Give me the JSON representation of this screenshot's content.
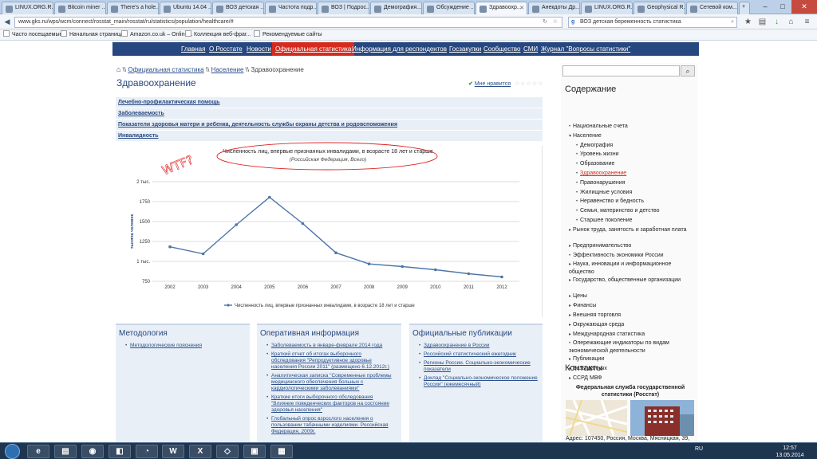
{
  "browser": {
    "tabs": [
      {
        "label": "LINUX.ORG.R...",
        "icon": "globe-icon"
      },
      {
        "label": "Bitcoin miner ...",
        "icon": "bitcoin-icon"
      },
      {
        "label": "There's a hole...",
        "icon": "hole-icon"
      },
      {
        "label": "Ubuntu 14.04 ...",
        "icon": "ubuntu-icon"
      },
      {
        "label": "ВОЗ детская ...",
        "icon": "google-icon"
      },
      {
        "label": "Частота подр...",
        "icon": "wikipedia-icon"
      },
      {
        "label": "ВОЗ | Подрос...",
        "icon": "who-icon"
      },
      {
        "label": "Демография...",
        "icon": "wikipedia-icon"
      },
      {
        "label": "Обсуждение ...",
        "icon": "c-icon"
      },
      {
        "label": "Здравоохр...",
        "icon": "rosstat-icon",
        "active": true
      },
      {
        "label": "Анекдоты Др...",
        "icon": "smile-icon"
      },
      {
        "label": "LINUX.ORG.R...",
        "icon": "globe-icon"
      },
      {
        "label": "Geophysical R...",
        "icon": "wikipedia-icon"
      },
      {
        "label": "Сетевой ком...",
        "icon": "wikipedia-icon"
      }
    ],
    "url": "www.gks.ru/wps/wcm/connect/rosstat_main/rosstat/ru/statistics/population/healthcare/#",
    "search_value": "ВОЗ детская беременность статистика",
    "bookmarks": [
      {
        "label": "Часто посещаемые"
      },
      {
        "label": "Начальная страница"
      },
      {
        "label": "Amazon.co.uk – Online..."
      },
      {
        "label": "Коллекция веб-фраг..."
      },
      {
        "label": "Рекомендуемые сайты"
      }
    ]
  },
  "site": {
    "nav": [
      {
        "label": "Главная"
      },
      {
        "label": "О Росстате"
      },
      {
        "label": "Новости"
      },
      {
        "label": "Официальная статистика",
        "active": true
      },
      {
        "label": "Информация для респондентов"
      },
      {
        "label": "Госзакупки"
      },
      {
        "label": "Сообщество"
      },
      {
        "label": "СМИ"
      },
      {
        "label": "Журнал \"Вопросы статистики\""
      }
    ],
    "breadcrumb": {
      "sep": "\\\\",
      "items": [
        "Официальная статистика",
        "Население",
        "Здравоохранение"
      ]
    },
    "page_title": "Здравоохранение",
    "like_label": "Мне нравится",
    "rating_stars": "☆☆☆☆☆",
    "sublinks": [
      "Лечебно-профилактическая помощь",
      "Заболеваемость",
      "Показатели здоровья матери и ребенка, деятельность службы охраны детства и родовспоможения",
      "Инвалидность"
    ],
    "annotation_text": "WTF?",
    "boxes": [
      {
        "title": "Методология",
        "items": [
          "Методологические пояснения"
        ]
      },
      {
        "title": "Оперативная информация",
        "items": [
          "Заболеваемость в январе-феврале 2014 года",
          "Краткий отчет об итогах выборочного обследования \"Репродуктивное здоровье населения России 2011\" (размещено 6.12.2012г.)",
          "Аналитическая записка \"Современные проблемы медицинского обеспечения больных с кардиологическими заболеваниями\"",
          "Краткие итоги выборочного обследования \"Влияние поведенческих факторов на состояние здоровья населения\"",
          "Глобальный опрос взрослого населения о пользовании табачными изделиями. Российская Федерация, 2009г."
        ]
      },
      {
        "title": "Официальные публикации",
        "items": [
          "Здравоохранение в России",
          "Российский статистический ежегодник",
          "Регионы России. Социально-экономические показатели",
          "Доклад \"Социально-экономическое положение России\" (ежемесячный)"
        ]
      }
    ],
    "sidebar": {
      "heading": "Содержание",
      "items": [
        {
          "label": "Национальные счета",
          "level": 0,
          "bullet": "•"
        },
        {
          "label": "Население",
          "level": 0,
          "bullet": "▾"
        },
        {
          "label": "Демография",
          "level": 1,
          "bullet": "•"
        },
        {
          "label": "Уровень жизни",
          "level": 1,
          "bullet": "•"
        },
        {
          "label": "Образование",
          "level": 1,
          "bullet": "•"
        },
        {
          "label": "Здравоохранение",
          "level": 1,
          "bullet": "•",
          "current": true
        },
        {
          "label": "Правонарушения",
          "level": 1,
          "bullet": "•"
        },
        {
          "label": "Жилищные условия",
          "level": 1,
          "bullet": "•"
        },
        {
          "label": "Неравенство и бедность",
          "level": 1,
          "bullet": "•"
        },
        {
          "label": "Семья, материнство и детство",
          "level": 1,
          "bullet": "•"
        },
        {
          "label": "Старшее поколение",
          "level": 1,
          "bullet": "•"
        },
        {
          "label": "Рынок труда, занятость и заработная плата",
          "level": 0,
          "bullet": "▸"
        },
        {
          "label": "Предпринимательство",
          "level": 0,
          "bullet": "▸"
        },
        {
          "label": "Эффективность экономики России",
          "level": 0,
          "bullet": "•"
        },
        {
          "label": "Наука, инновации и информационное общество",
          "level": 0,
          "bullet": "▸"
        },
        {
          "label": "Государство, общественные организации",
          "level": 0,
          "bullet": "▸"
        },
        {
          "label": "Цены",
          "level": 0,
          "bullet": "▸"
        },
        {
          "label": "Финансы",
          "level": 0,
          "bullet": "▸"
        },
        {
          "label": "Внешняя торговля",
          "level": 0,
          "bullet": "▸"
        },
        {
          "label": "Окружающая среда",
          "level": 0,
          "bullet": "▸"
        },
        {
          "label": "Международная статистика",
          "level": 0,
          "bullet": "▸"
        },
        {
          "label": "Опережающие индикаторы по видам экономической деятельности",
          "level": 0,
          "bullet": "•"
        },
        {
          "label": "Публикации",
          "level": 0,
          "bullet": "▸"
        },
        {
          "label": "Базы данных",
          "level": 0,
          "bullet": "▸"
        },
        {
          "label": "ССРД МВФ",
          "level": 0,
          "bullet": "▸"
        }
      ],
      "contacts_heading": "Контакты",
      "org_name": "Федеральная служба государственной статистики (Росстат)",
      "address": "Адрес: 107450, Россия, Москва, Мясницкая, 39,"
    }
  },
  "chart_data": {
    "type": "line",
    "title": "Численность лиц, впервые признанных инвалидами, в возрасте 18 лет и старше",
    "subtitle": "(Российская Федерация, Всего)",
    "ylabel": "тысяча человек",
    "xlabel": "",
    "x": [
      "2002",
      "2003",
      "2004",
      "2005",
      "2006",
      "2007",
      "2008",
      "2009",
      "2010",
      "2011",
      "2012"
    ],
    "series": [
      {
        "name": "Численность лиц, впервые признанных инвалидами, в возрасте 18 лет и старше",
        "values": [
          1183,
          1095,
          1460,
          1805,
          1475,
          1108,
          968,
          935,
          895,
          845,
          805
        ],
        "color": "#4f76a8"
      }
    ],
    "ylim": [
      750,
      2000
    ],
    "yticks": [
      750,
      1000,
      1250,
      1500,
      1750,
      2000
    ],
    "ytick_labels": [
      "750",
      "1 тыс.",
      "1250",
      "1500",
      "1750",
      "2 тыс."
    ],
    "grid": true,
    "legend": "bottom"
  },
  "taskbar": {
    "apps": [
      {
        "label": "e",
        "icon": "ie-icon"
      },
      {
        "label": "▤",
        "icon": "explorer-icon"
      },
      {
        "label": "◉",
        "icon": "firefox-icon"
      },
      {
        "label": "◧",
        "icon": "app-icon"
      },
      {
        "label": "◔",
        "icon": "app2-icon"
      },
      {
        "label": "W",
        "icon": "word-icon"
      },
      {
        "label": "X",
        "icon": "excel-icon"
      },
      {
        "label": "◇",
        "icon": "app3-icon"
      },
      {
        "label": "▣",
        "icon": "virtualbox-icon"
      },
      {
        "label": "▦",
        "icon": "remote-icon"
      }
    ],
    "lang": "RU",
    "time": "12:57",
    "date": "13.05.2014"
  }
}
